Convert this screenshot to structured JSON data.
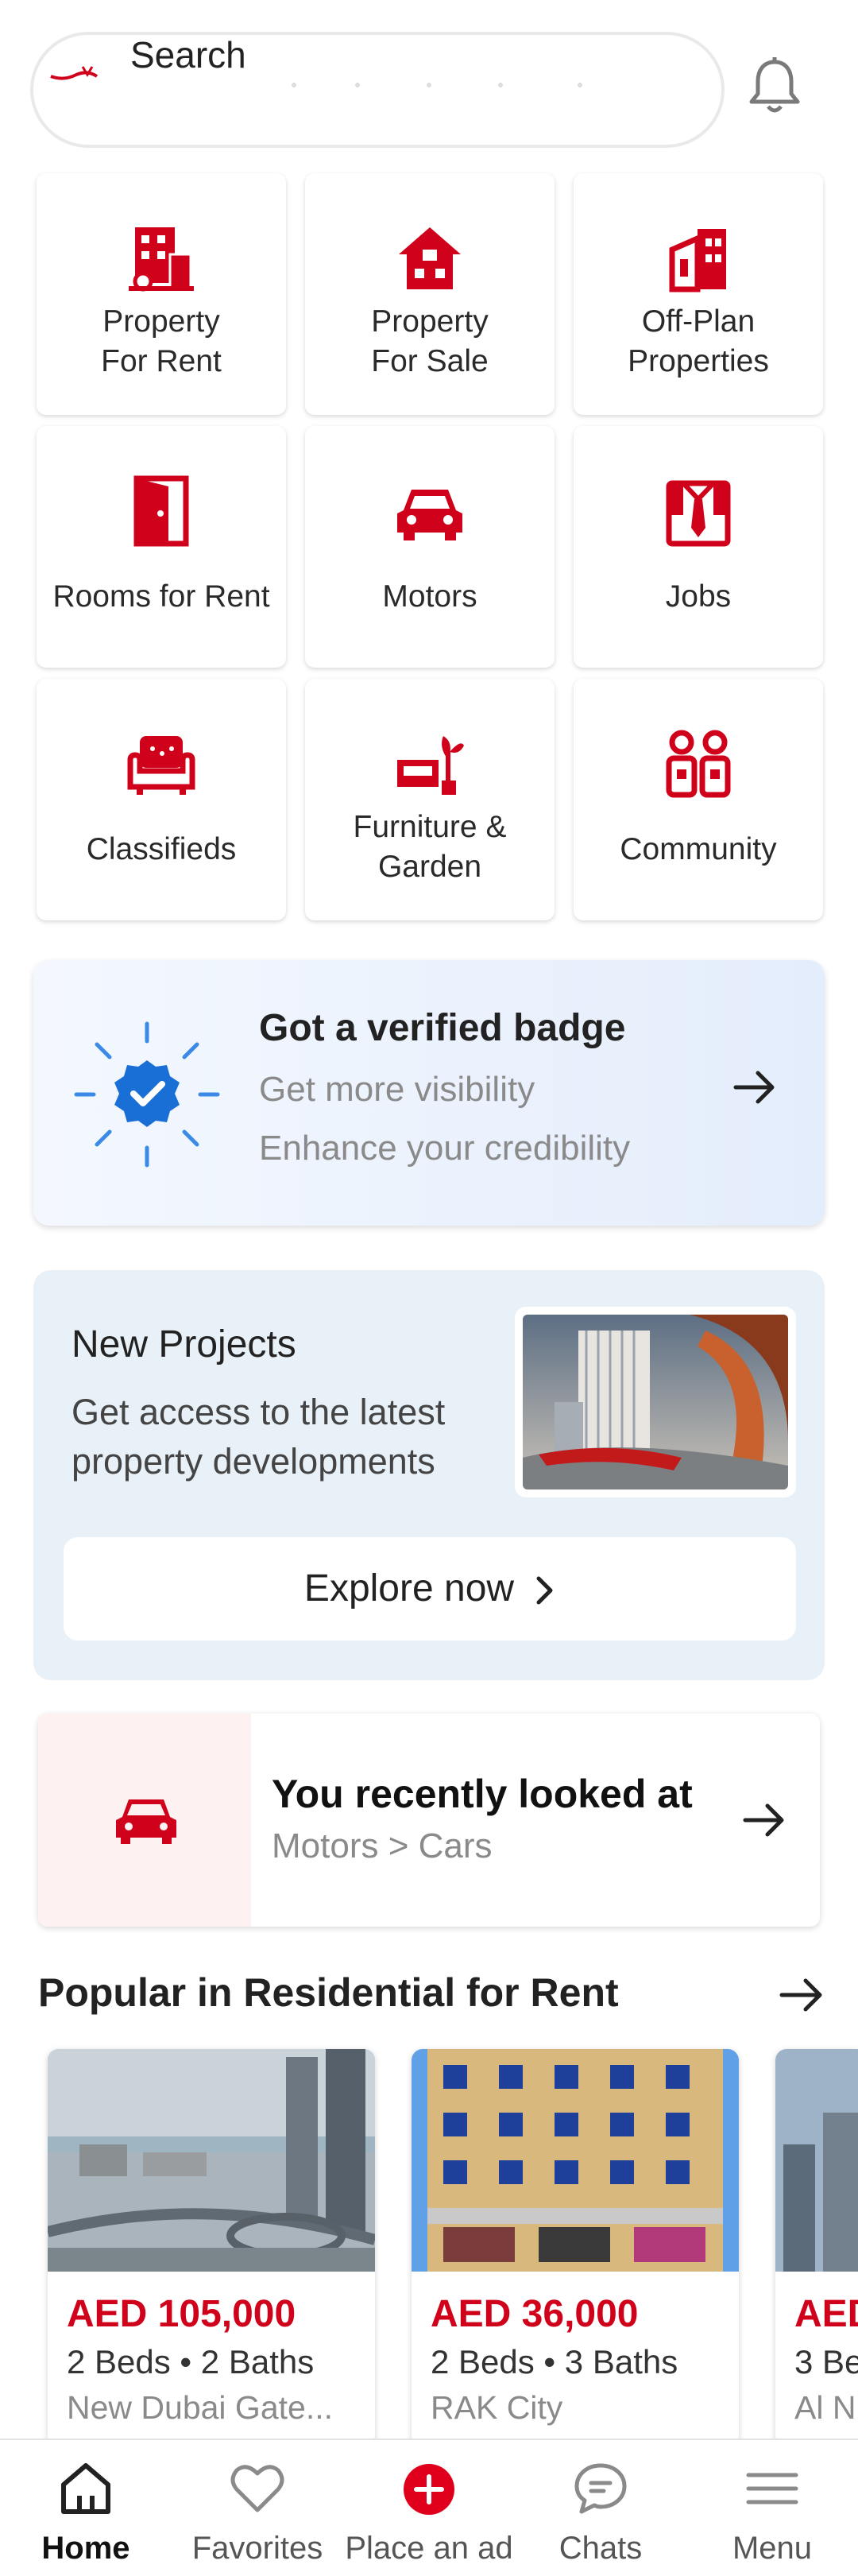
{
  "search": {
    "placeholder_label": "Search"
  },
  "categories": [
    {
      "label_line1": "Property",
      "label_line2": "For Rent",
      "icon": "building-icon"
    },
    {
      "label_line1": "Property",
      "label_line2": "For Sale",
      "icon": "house-icon"
    },
    {
      "label_line1": "Off-Plan",
      "label_line2": "Properties",
      "icon": "offplan-building-icon"
    },
    {
      "label_line1": "Rooms for Rent",
      "label_line2": "",
      "icon": "door-icon"
    },
    {
      "label_line1": "Motors",
      "label_line2": "",
      "icon": "car-icon"
    },
    {
      "label_line1": "Jobs",
      "label_line2": "",
      "icon": "shirt-tie-icon"
    },
    {
      "label_line1": "Classifieds",
      "label_line2": "",
      "icon": "armchair-icon"
    },
    {
      "label_line1": "Furniture &",
      "label_line2": "Garden",
      "icon": "sofa-plant-icon"
    },
    {
      "label_line1": "Community",
      "label_line2": "",
      "icon": "people-icon"
    }
  ],
  "verified": {
    "title": "Got a verified badge",
    "line1": "Get more visibility",
    "line2": "Enhance your credibility"
  },
  "projects": {
    "title": "New Projects",
    "subtitle": "Get access to the latest property developments",
    "button": "Explore now"
  },
  "recent": {
    "title": "You recently looked at",
    "subtitle": "Motors > Cars"
  },
  "popular": {
    "title": "Popular in Residential for Rent",
    "listings": [
      {
        "price": "AED 105,000",
        "beds": "2 Beds • 2 Baths",
        "location": "New Dubai Gate..."
      },
      {
        "price": "AED 36,000",
        "beds": "2 Beds • 3 Baths",
        "location": "RAK City"
      },
      {
        "price": "AED",
        "beds": "3 Be",
        "location": "Al N"
      }
    ]
  },
  "nav": {
    "home": "Home",
    "favorites": "Favorites",
    "place_ad": "Place an ad",
    "chats": "Chats",
    "menu": "Menu"
  },
  "colors": {
    "brand_red": "#d0021b",
    "verified_blue": "#1a6fd6"
  }
}
